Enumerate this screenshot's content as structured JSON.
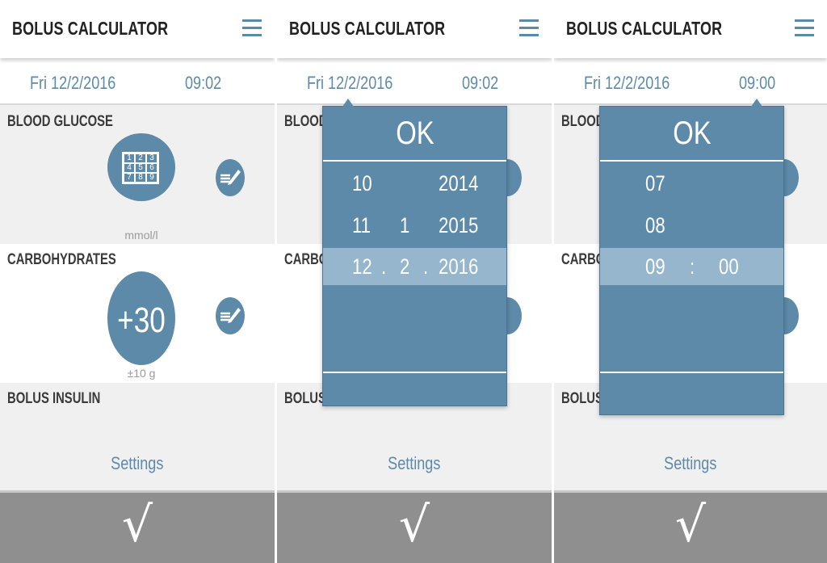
{
  "app": {
    "title": "BOLUS CALCULATOR"
  },
  "screens": [
    {
      "date": "Fri 12/2/2016",
      "time": "09:02"
    },
    {
      "date": "Fri 12/2/2016",
      "time": "09:02"
    },
    {
      "date": "Fri 12/2/2016",
      "time": "09:00"
    }
  ],
  "sections": {
    "glucose": {
      "label": "BLOOD GLUCOSE",
      "label_cut": "BLOOD",
      "unit": "mmol/l",
      "keypad": [
        "1",
        "2",
        "3",
        "4",
        "5",
        "6",
        "7",
        "8",
        "9"
      ]
    },
    "carbs": {
      "label": "CARBOHYDRATES",
      "label_cut": "CARBOI",
      "value": "+30",
      "unit": "±10 g"
    },
    "bolus": {
      "label": "BOLUS INSULIN",
      "label_cut": "BOLUS",
      "settings": "Settings"
    }
  },
  "confirm": {
    "symbol": "√"
  },
  "date_picker": {
    "ok": "OK",
    "rows": [
      {
        "day": "10",
        "month": "",
        "year": "2014"
      },
      {
        "day": "11",
        "month": "1",
        "year": "2015"
      },
      {
        "day": "12",
        "month": "2",
        "year": "2016",
        "sep": "."
      }
    ]
  },
  "time_picker": {
    "ok": "OK",
    "rows": [
      {
        "hour": "07",
        "minute": ""
      },
      {
        "hour": "08",
        "minute": ""
      },
      {
        "hour": "09",
        "minute": "00",
        "sep": ":"
      }
    ]
  },
  "colors": {
    "accent": "#5d8aa8",
    "selected_row": "#95b6cc",
    "confirm_bar": "#8f8f8f"
  }
}
